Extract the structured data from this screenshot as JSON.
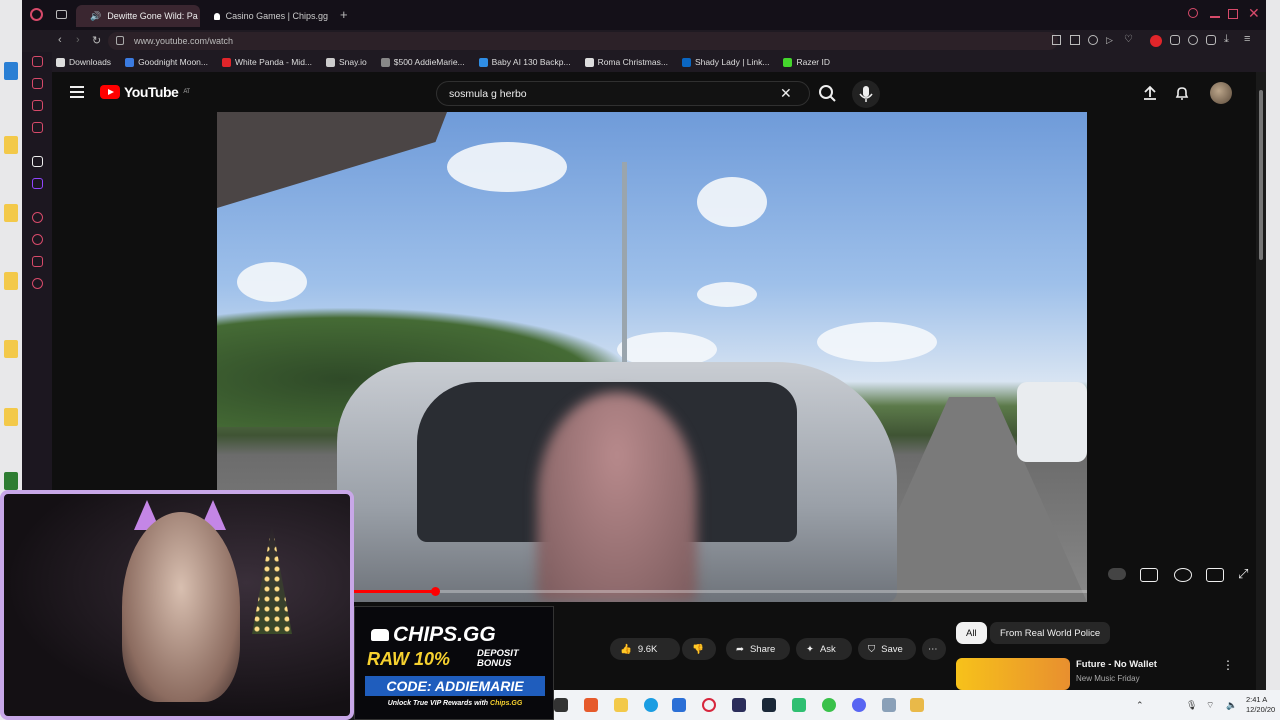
{
  "browser": {
    "tabs": [
      {
        "label": "Dewitte Gone Wild: Pa",
        "active": true
      },
      {
        "label": "Casino Games | Chips.gg",
        "active": false
      }
    ],
    "new_tab": "+",
    "url": "www.youtube.com/watch",
    "bookmarks": [
      {
        "label": "Downloads",
        "color": "#dddddd"
      },
      {
        "label": "Goodnight Moon...",
        "color": "#3b7be0"
      },
      {
        "label": "White Panda - Mid...",
        "color": "#e0252a"
      },
      {
        "label": "Snay.io",
        "color": "#cccccc"
      },
      {
        "label": "$500 AddieMarie...",
        "color": "#888888"
      },
      {
        "label": "Baby AI 130 Backp...",
        "color": "#2f8de4"
      },
      {
        "label": "Roma Christmas...",
        "color": "#dddddd"
      },
      {
        "label": "Shady Lady | Link...",
        "color": "#0a66c2"
      },
      {
        "label": "Razer ID",
        "color": "#44d62c"
      }
    ]
  },
  "youtube": {
    "logo": "YouTube",
    "country": "AT",
    "search_value": "sosmula g herbo",
    "actions": {
      "likes": "9.6K",
      "share": "Share",
      "ask": "Ask",
      "save": "Save",
      "more": "⋯"
    },
    "chips": [
      "All",
      "From Real World Police"
    ],
    "related": {
      "title": "Future - No Wallet",
      "subtitle": "New Music Friday"
    },
    "progress": 0.25
  },
  "ad": {
    "title": "CHIPS.GG",
    "raw": "RAW 10%",
    "bonus_line1": "DEPOSIT",
    "bonus_line2": "BONUS",
    "code": "CODE: ADDIEMARIE",
    "footer_prefix": "Unlock True VIP Rewards with ",
    "footer_brand": "Chips.GG"
  },
  "taskbar": {
    "time": "2:41 A",
    "date": "12/20/20"
  },
  "colors": {
    "accent": "#d74a6a",
    "yt_red": "#ff0000",
    "cam_border": "#c8a7e8"
  }
}
